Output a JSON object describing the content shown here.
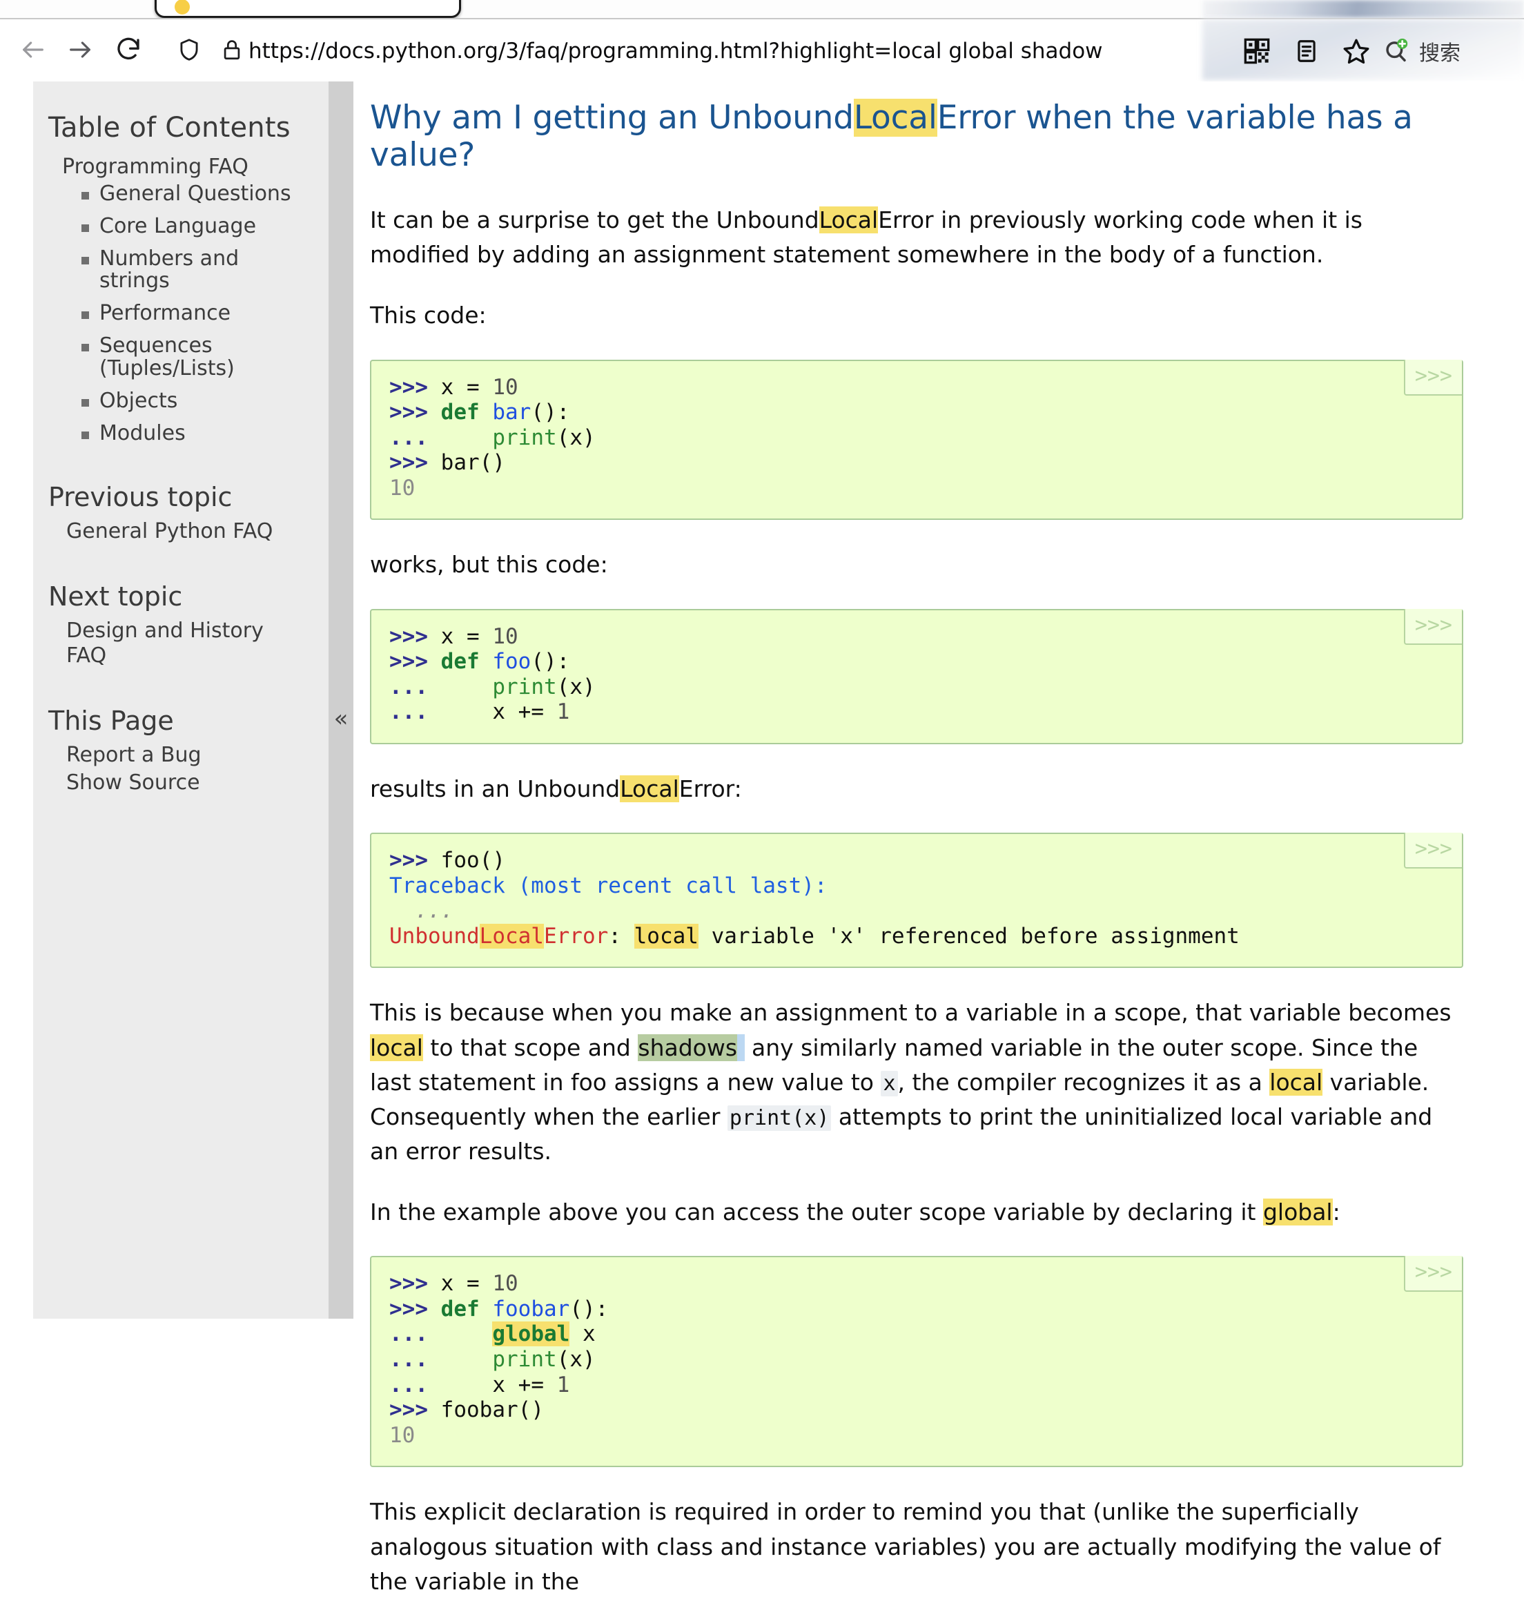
{
  "browser": {
    "url": "https://docs.python.org/3/faq/programming.html?highlight=local global shadow",
    "nav": {
      "back": "Back",
      "forward": "Forward",
      "reload": "Reload",
      "shield": "Tracking Protection",
      "lock": "Site Security"
    },
    "actions": {
      "qrcode": "QR Code",
      "reader": "Reader View",
      "bookmark": "Bookmark",
      "search_label": "搜索"
    }
  },
  "sidebar": {
    "toc_title": "Table of Contents",
    "toc_root": "Programming FAQ",
    "toc_items": [
      "General Questions",
      "Core Language",
      "Numbers and strings",
      "Performance",
      "Sequences (Tuples/Lists)",
      "Objects",
      "Modules"
    ],
    "previous_topic_title": "Previous topic",
    "previous_topic_link": "General Python FAQ",
    "next_topic_title": "Next topic",
    "next_topic_link": "Design and History FAQ",
    "this_page_title": "This Page",
    "this_page_links": [
      "Report a Bug",
      "Show Source"
    ],
    "collapse_handle": "«"
  },
  "main": {
    "title_before": "Why am I getting an Unbound",
    "title_highlight": "Local",
    "title_after": "Error when the variable has a value?",
    "p1_a": "It can be a surprise to get the Unbound",
    "p1_hl": "Local",
    "p1_b": "Error in previously working code when it is modified by adding an assignment statement somewhere in the body of a function.",
    "p2": "This code:",
    "p3": "works, but this code:",
    "p4_a": "results in an Unbound",
    "p4_hl": "Local",
    "p4_b": "Error:",
    "p5_1": "This is because when you make an assignment to a variable in a scope, that variable becomes ",
    "p5_hl1": "local",
    "p5_2": " to that scope and ",
    "p5_hl2": "shadows",
    "p5_3": " any similarly named variable in the outer scope. Since the last statement in foo assigns a new value to ",
    "p5_code1": "x",
    "p5_4": ", the compiler recognizes it as a ",
    "p5_hl3": "local",
    "p5_5": " variable. Consequently when the earlier ",
    "p5_code2": "print(x)",
    "p5_6": " attempts to print the uninitialized local variable and an error results.",
    "p6_a": "In the example above you can access the outer scope variable by declaring it ",
    "p6_hl": "global",
    "p6_b": ":",
    "p7": "This explicit declaration is required in order to remind you that (unlike the superficially analogous situation with class and instance variables) you are actually modifying the value of the variable in the",
    "copy_button_label": ">>>",
    "code_blocks": [
      {
        "id": "code-bar",
        "lines": [
          ">>> x = 10",
          ">>> def bar():",
          "...     print(x)",
          ">>> bar()",
          "10"
        ]
      },
      {
        "id": "code-foo",
        "lines": [
          ">>> x = 10",
          ">>> def foo():",
          "...     print(x)",
          "...     x += 1"
        ]
      },
      {
        "id": "code-traceback",
        "lines": [
          ">>> foo()",
          "Traceback (most recent call last):",
          "  ...",
          "UnboundLocalError: local variable 'x' referenced before assignment"
        ]
      },
      {
        "id": "code-foobar",
        "lines": [
          ">>> x = 10",
          ">>> def foobar():",
          "...     global x",
          "...     print(x)",
          "...     x += 1",
          ">>> foobar()",
          "10"
        ]
      }
    ]
  },
  "colors": {
    "heading": "#1a5490",
    "highlight_yellow": "#f7e06e",
    "highlight_green": "#b7cca1",
    "code_bg": "#eeffcc",
    "code_border": "#aacc99",
    "sidebar_bg": "#ececec"
  }
}
